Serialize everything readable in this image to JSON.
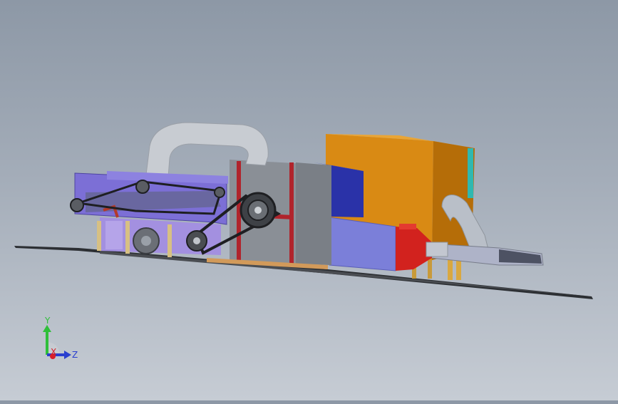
{
  "triad": {
    "y_label": "Y",
    "x_label": "X",
    "z_label": "Z",
    "colors": {
      "y": "#2fbf3a",
      "x": "#d8202a",
      "z": "#2a3fcf"
    }
  },
  "model_colors": {
    "base_plate": "#2c2f33",
    "duct": "#c8ccd2",
    "feeder_frame": "#7c6fd6",
    "main_cabinet": "#8a8f96",
    "cabinet_trim": "#b0242c",
    "blue_box": "#2a32a8",
    "orange_box": "#d98a14",
    "hopper": "#7b7fd9",
    "red_nozzle": "#d2221e",
    "belt": "#1e1f22"
  }
}
